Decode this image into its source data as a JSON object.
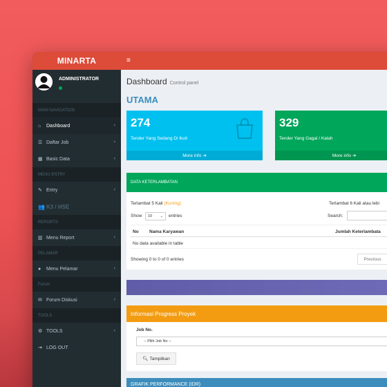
{
  "app": {
    "title": "MINARTA"
  },
  "user": {
    "name": "ADMINISTRATOR"
  },
  "sidebar": {
    "sec_main": "MAIN NAVIGATION",
    "dashboard": "Dashboard",
    "daftar_job": "Daftar Job",
    "basic_data": "Basic Data",
    "sec_menu_entry": "MENU ENTRY",
    "entry": "Entry",
    "k3": "K3 / HSE",
    "sec_reports": "REPORTS",
    "menu_report": "Menu Report",
    "sec_pelamar": "PELAMAR",
    "menu_pelamar": "Menu Pelamar",
    "sec_forum": "Forum",
    "forum_diskusi": "Forum Diskusi",
    "sec_tools": "TOOLS",
    "tools": "TOOLS",
    "logout": "LOG OUT"
  },
  "header": {
    "title": "Dashboard",
    "subtitle": "Control panel",
    "section": "UTAMA"
  },
  "stats": [
    {
      "value": "274",
      "label": "Tender Yang Sedang Di Ikuti",
      "more": "More info"
    },
    {
      "value": "329",
      "label": "Tender Yang Gagal / Kalah",
      "more": "More info"
    }
  ],
  "late_panel": {
    "title": "DATA KETERLAMBATAN",
    "left_prefix": "Terlambat 5 Kali ",
    "left_highlight": "(Kuning)",
    "right_text": "Terlambat 6 Kali atau lebi",
    "show": "Show",
    "entries_value": "10",
    "entries": "entries",
    "search_label": "Search:",
    "col_no": "No",
    "col_name": "Nama Karyawan",
    "col_count": "Jumlah Keterlambata",
    "empty": "No data available in table",
    "showing": "Showing 0 to 0 of 0 entries",
    "prev": "Previous"
  },
  "progress_panel": {
    "title": "Informasi Progress Proyek",
    "job_label": "Job No.",
    "job_placeholder": "-- Pilih Job No --",
    "button": "Tampilkan"
  },
  "grafik": {
    "title": "GRAFIK PERFORMANCE (IDR)"
  },
  "colors": {
    "background": "#ec5253",
    "logo": "#dd4b39",
    "sidebar": "#222d32",
    "aqua": "#00c0ef",
    "green": "#00a65a",
    "yellow": "#f39c12",
    "purple": "#605ca8",
    "blue": "#3c8dbc"
  }
}
